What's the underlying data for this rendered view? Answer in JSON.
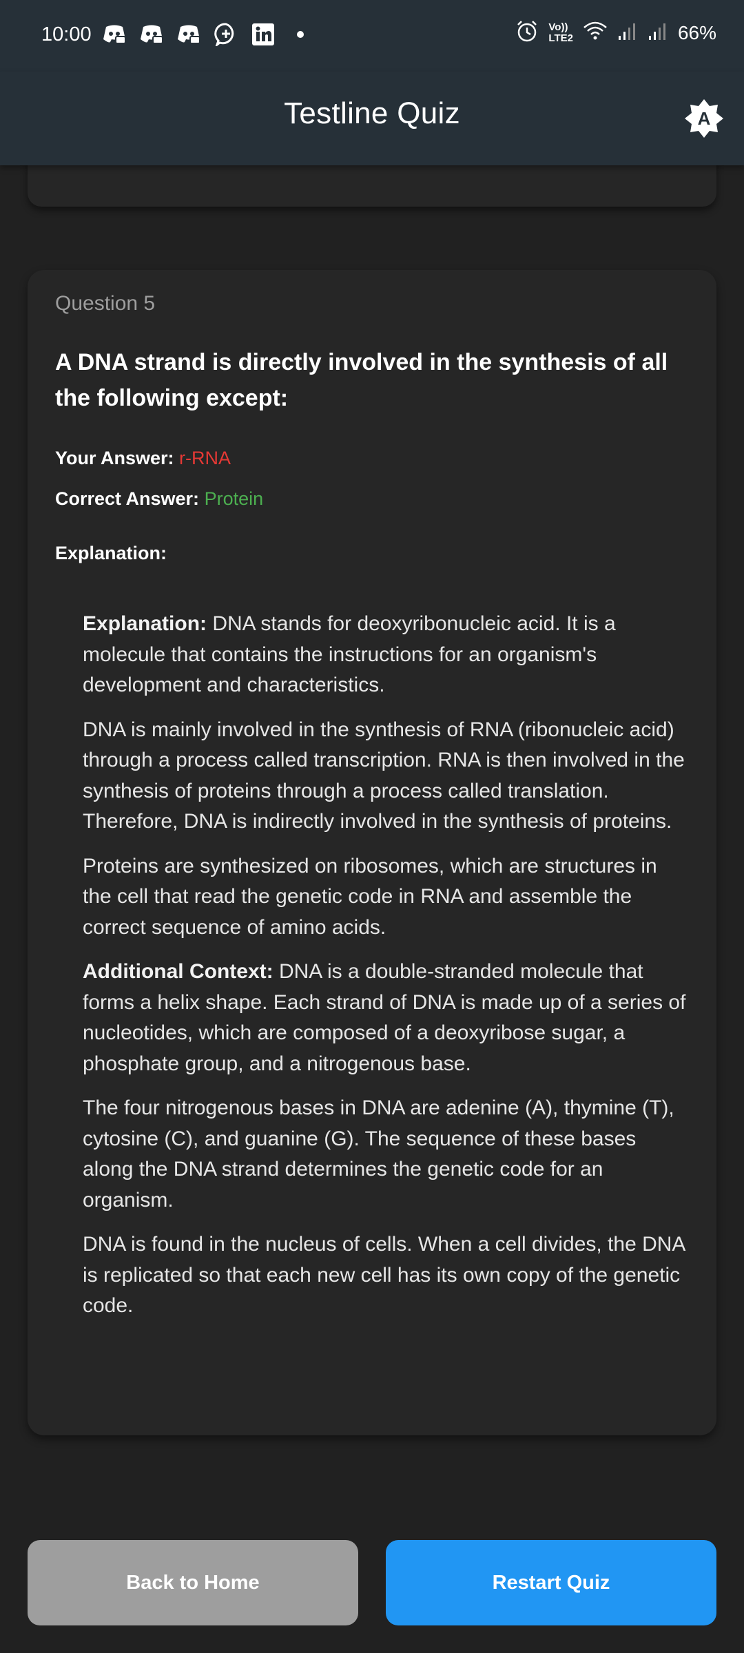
{
  "status_bar": {
    "time": "10:00",
    "battery": "66%",
    "left_icons": [
      "discord-icon",
      "discord-icon",
      "discord-icon",
      "chat-plus-icon",
      "linkedin-icon",
      "dot-icon"
    ],
    "right_icons": [
      "alarm-icon",
      "volte-icon",
      "wifi-icon",
      "signal-icon",
      "signal-icon"
    ],
    "lte_label_top": "Vo))",
    "lte_label_bottom": "LTE2"
  },
  "app_bar": {
    "title": "Testline Quiz",
    "theme_icon_letter": "A"
  },
  "question": {
    "label": "Question 5",
    "text": "A DNA strand is directly involved in the synthesis of all the following except:",
    "your_answer_label": "Your Answer:",
    "your_answer_value": "r-RNA",
    "correct_answer_label": "Correct Answer:",
    "correct_answer_value": "Protein",
    "explanation_heading": "Explanation:"
  },
  "explanation": {
    "p1_lead": "Explanation:",
    "p1_text": " DNA stands for deoxyribonucleic acid. It is a molecule that contains the instructions for an organism's development and characteristics.",
    "p2": "DNA is mainly involved in the synthesis of RNA (ribonucleic acid) through a process called transcription. RNA is then involved in the synthesis of proteins through a process called translation. Therefore, DNA is indirectly involved in the synthesis of proteins.",
    "p3": "Proteins are synthesized on ribosomes, which are structures in the cell that read the genetic code in RNA and assemble the correct sequence of amino acids.",
    "p4_lead": "Additional Context:",
    "p4_text": " DNA is a double-stranded molecule that forms a helix shape. Each strand of DNA is made up of a series of nucleotides, which are composed of a deoxyribose sugar, a phosphate group, and a nitrogenous base.",
    "p5": "The four nitrogenous bases in DNA are adenine (A), thymine (T), cytosine (C), and guanine (G). The sequence of these bases along the DNA strand determines the genetic code for an organism.",
    "p6": "DNA is found in the nucleus of cells. When a cell divides, the DNA is replicated so that each new cell has its own copy of the genetic code."
  },
  "buttons": {
    "back_home": "Back to Home",
    "restart": "Restart Quiz"
  },
  "colors": {
    "wrong": "#e53935",
    "correct": "#4caf50",
    "primary": "#2196f3",
    "secondary": "#9e9e9e"
  }
}
